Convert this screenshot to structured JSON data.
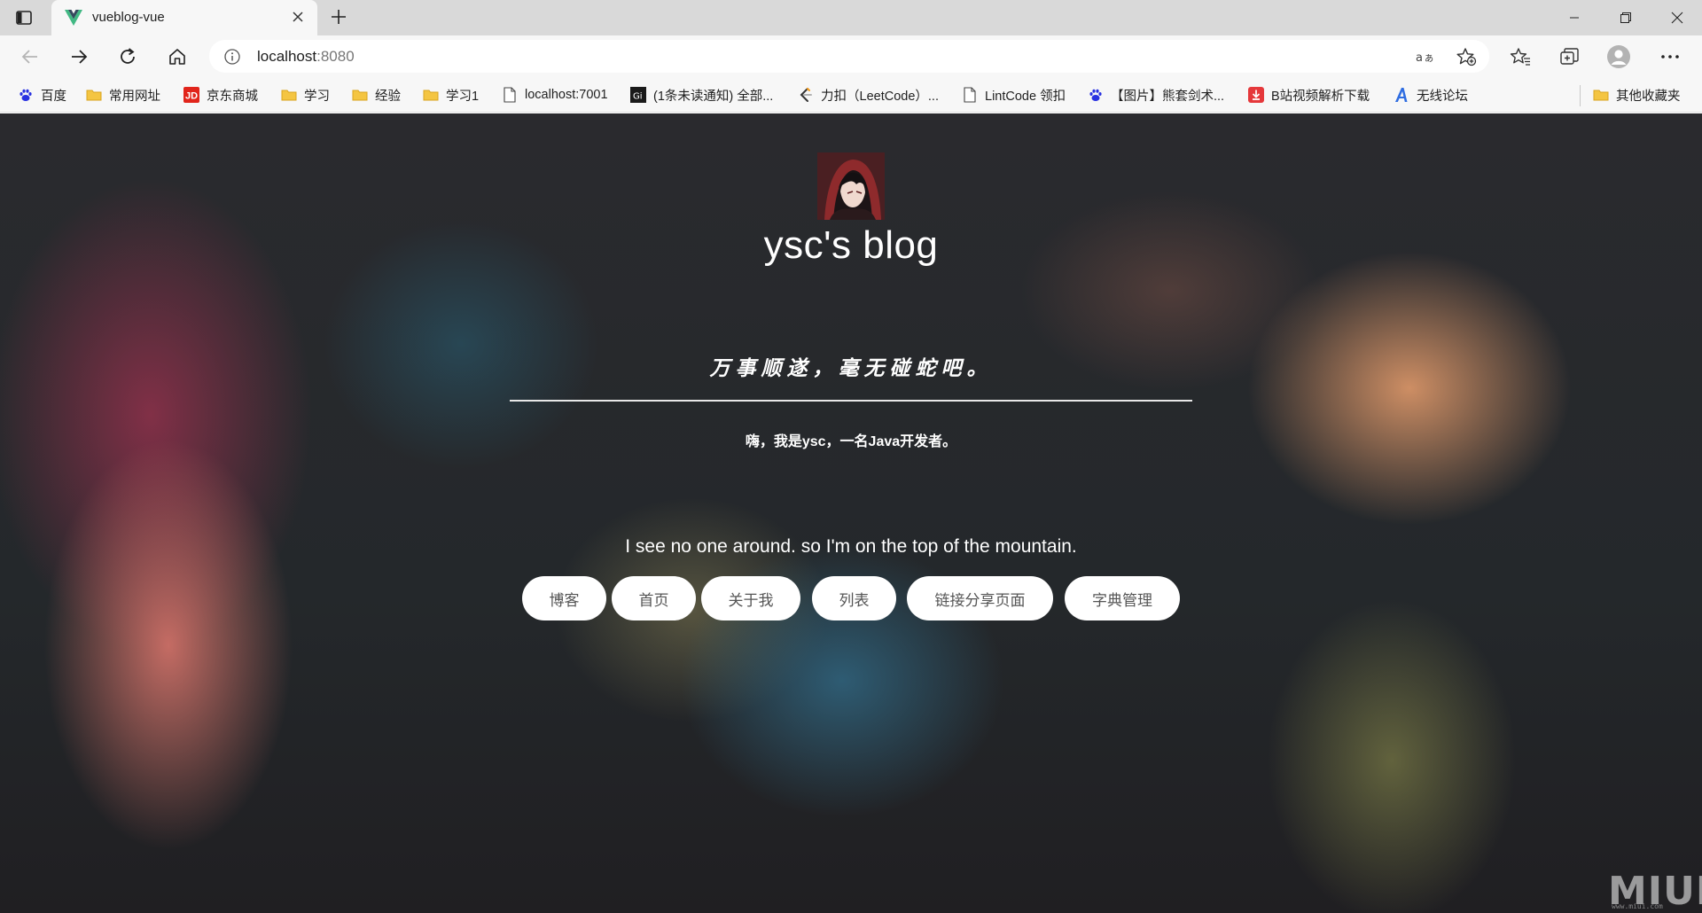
{
  "browser": {
    "tab_title": "vueblog-vue",
    "address_host": "localhost",
    "address_port": ":8080",
    "icons": [
      "sidebar-toggle-icon",
      "vue-logo-icon",
      "close-icon",
      "plus-icon",
      "minimize-icon",
      "restore-icon",
      "close-window-icon",
      "back-icon",
      "forward-icon",
      "refresh-icon",
      "home-icon",
      "info-icon",
      "read-aloud-icon",
      "add-favorite-icon",
      "favorites-icon",
      "collections-icon",
      "profile-icon",
      "more-icon"
    ]
  },
  "bookmarks": [
    {
      "label": "百度",
      "icon": "baidu-paw-icon"
    },
    {
      "label": "常用网址",
      "icon": "folder-icon"
    },
    {
      "label": "京东商城",
      "icon": "jd-icon"
    },
    {
      "label": "学习",
      "icon": "folder-icon"
    },
    {
      "label": "经验",
      "icon": "folder-icon"
    },
    {
      "label": "学习1",
      "icon": "folder-icon"
    },
    {
      "label": "localhost:7001",
      "icon": "page-icon"
    },
    {
      "label": "(1条未读通知) 全部...",
      "icon": "zhihu-icon"
    },
    {
      "label": "力扣（LeetCode）...",
      "icon": "leetcode-icon"
    },
    {
      "label": "LintCode 领扣",
      "icon": "page-icon"
    },
    {
      "label": "【图片】熊套剑术...",
      "icon": "baidu-paw-icon"
    },
    {
      "label": "B站视频解析下载",
      "icon": "download-icon"
    },
    {
      "label": "无线论坛",
      "icon": "a-logo-icon"
    }
  ],
  "other_bookmarks": {
    "label": "其他收藏夹",
    "icon": "folder-icon"
  },
  "page": {
    "blog_title": "ysc's blog",
    "motto": "万事顺遂，毫无碰蛇吧。",
    "intro": "嗨，我是ysc，一名Java开发者。",
    "tagline": "I see no one around. so I'm on the top of the mountain.",
    "nav": [
      "博客",
      "首页",
      "关于我",
      "列表",
      "链接分享页面",
      "字典管理"
    ],
    "watermark": "MIUI",
    "watermark_sub": "www.miui.com"
  },
  "colors": {
    "bookmark_folder": "#f4c542",
    "vue_green": "#41b883",
    "jd_red": "#e1251b",
    "baidu_blue": "#2932e1"
  }
}
